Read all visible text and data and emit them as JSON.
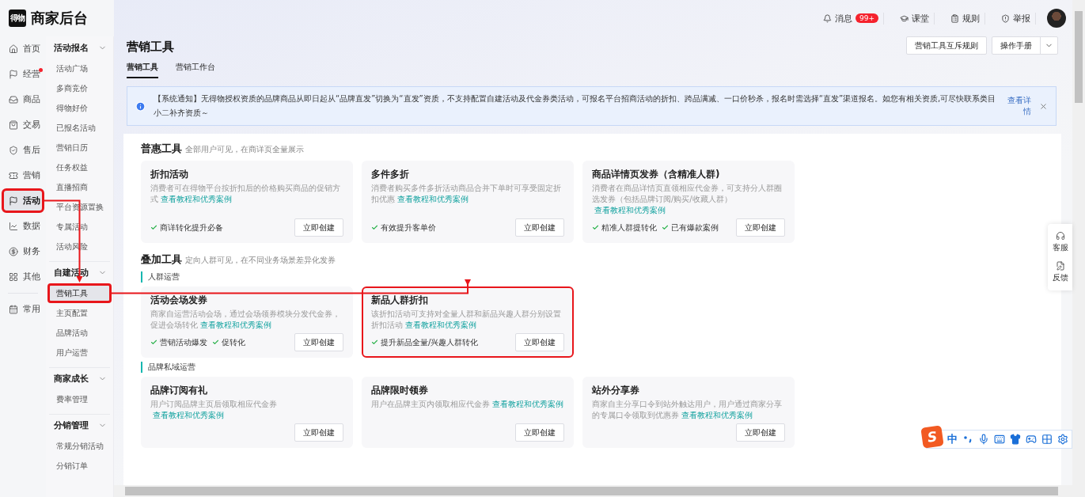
{
  "header": {
    "logo_mark": "得物",
    "title": "商家后台",
    "links": [
      {
        "kind": "messages",
        "label": "消息",
        "badge": "99+"
      },
      {
        "kind": "class",
        "label": "课堂"
      },
      {
        "kind": "rules",
        "label": "规则"
      },
      {
        "kind": "report",
        "label": "举报"
      }
    ]
  },
  "nav": [
    {
      "kind": "home",
      "label": "首页",
      "selected": false,
      "unread": false,
      "highlighted": false
    },
    {
      "kind": "flag",
      "label": "经营",
      "selected": false,
      "unread": true,
      "highlighted": false
    },
    {
      "kind": "goods",
      "label": "商品",
      "selected": false,
      "unread": false,
      "highlighted": false
    },
    {
      "kind": "trade",
      "label": "交易",
      "selected": false,
      "unread": false,
      "highlighted": false
    },
    {
      "kind": "aftersale",
      "label": "售后",
      "selected": false,
      "unread": false,
      "highlighted": false
    },
    {
      "kind": "marketing",
      "label": "营销",
      "selected": false,
      "unread": false,
      "highlighted": false
    },
    {
      "kind": "flag",
      "label": "活动",
      "selected": true,
      "unread": false,
      "highlighted": true
    },
    {
      "kind": "data",
      "label": "数据",
      "selected": false,
      "unread": false,
      "highlighted": false
    },
    {
      "kind": "finance",
      "label": "财务",
      "selected": false,
      "unread": false,
      "highlighted": false
    },
    {
      "kind": "other",
      "label": "其他",
      "selected": false,
      "unread": false,
      "highlighted": false
    },
    {
      "kind": "common",
      "label": "常用",
      "selected": false,
      "unread": false,
      "highlighted": false
    }
  ],
  "submenu": [
    {
      "title": "活动报名",
      "expanded": true,
      "items": [
        {
          "label": "活动广场",
          "selected": false,
          "highlighted": false
        },
        {
          "label": "多商竞价",
          "selected": false,
          "highlighted": false
        },
        {
          "label": "得物好价",
          "selected": false,
          "highlighted": false
        },
        {
          "label": "已报名活动",
          "selected": false,
          "highlighted": false
        },
        {
          "label": "营销日历",
          "selected": false,
          "highlighted": false
        },
        {
          "label": "任务权益",
          "selected": false,
          "highlighted": false
        },
        {
          "label": "直播招商",
          "selected": false,
          "highlighted": false
        },
        {
          "label": "平台资源置换",
          "selected": false,
          "highlighted": false
        },
        {
          "label": "专属活动",
          "selected": false,
          "highlighted": false
        },
        {
          "label": "活动风险",
          "selected": false,
          "highlighted": false
        }
      ]
    },
    {
      "title": "自建活动",
      "expanded": true,
      "items": [
        {
          "label": "营销工具",
          "selected": true,
          "highlighted": true
        },
        {
          "label": "主页配置",
          "selected": false,
          "highlighted": false
        },
        {
          "label": "品牌活动",
          "selected": false,
          "highlighted": false
        },
        {
          "label": "用户运营",
          "selected": false,
          "highlighted": false
        }
      ]
    },
    {
      "title": "商家成长",
      "expanded": true,
      "items": [
        {
          "label": "费率管理",
          "selected": false,
          "highlighted": false
        }
      ]
    },
    {
      "title": "分销管理",
      "expanded": true,
      "items": [
        {
          "label": "常规分销活动",
          "selected": false,
          "highlighted": false
        },
        {
          "label": "分销订单",
          "selected": false,
          "highlighted": false
        }
      ]
    }
  ],
  "page": {
    "title": "营销工具",
    "tabs": [
      {
        "label": "营销工具",
        "selected": true
      },
      {
        "label": "营销工作台",
        "selected": false
      }
    ],
    "rules_button": "营销工具互斥规则",
    "manual_button": "操作手册"
  },
  "notice": {
    "text": "【系统通知】无得物授权资质的品牌商品从即日起从“品牌直发”切换为“直发”资质，不支持配置自建活动及代金券类活动，可报名平台招商活动的折扣、跨品满减、一口价秒杀，报名时需选择“直发”渠道报名。如您有相关资质,可尽快联系类目小二补齐资质～",
    "link": "查看详情"
  },
  "sections": [
    {
      "title": "普惠工具",
      "subtitle": "全部用户可见，在商详页全量展示",
      "groups": [
        {
          "cards": [
            {
              "title": "折扣活动",
              "description": "消费者可在得物平台按折扣后的价格购买商品的促销方式",
              "link": "查看教程和优秀案例",
              "features": [
                "商详转化提升必备"
              ],
              "button": "立即创建",
              "highlighted": false
            },
            {
              "title": "多件多折",
              "description": "消费者购买多件多折活动商品合并下单时可享受固定折扣优惠",
              "link": "查看教程和优秀案例",
              "features": [
                "有效提升客单价"
              ],
              "button": "立即创建",
              "highlighted": false
            },
            {
              "title": "商品详情页发券（含精准人群)",
              "description": "消费者在商品详情页直领相应代金券，可支持分人群圈选发券（包括品牌订阅/购买/收藏人群）",
              "link": "查看教程和优秀案例",
              "features": [
                "精准人群提转化",
                "已有爆款案例"
              ],
              "button": "立即创建",
              "highlighted": false
            }
          ]
        }
      ]
    },
    {
      "title": "叠加工具",
      "subtitle": "定向人群可见，在不同业务场景差异化发券",
      "groups": [
        {
          "label": "人群运营",
          "cards": [
            {
              "title": "活动会场发券",
              "description": "商家自运营活动会场，通过会场领券模块分发代金券，促进会场转化",
              "link": "查看教程和优秀案例",
              "features": [
                "营销活动爆发",
                "促转化"
              ],
              "button": "立即创建",
              "highlighted": false
            },
            {
              "title": "新品人群折扣",
              "description": "该折扣活动可支持对全量人群和新品兴趣人群分别设置折扣活动",
              "link": "查看教程和优秀案例",
              "features": [
                "提升新品全量/兴趣人群转化"
              ],
              "button": "立即创建",
              "highlighted": true
            }
          ]
        },
        {
          "label": "品牌私域运营",
          "cards": [
            {
              "title": "品牌订阅有礼",
              "description": "用户订阅品牌主页后领取相应代金券",
              "link": "查看教程和优秀案例",
              "button": "立即创建",
              "highlighted": false
            },
            {
              "title": "品牌限时领券",
              "description": "用户在品牌主页内领取相应代金券",
              "link": "查看教程和优秀案例",
              "button": "立即创建",
              "highlighted": false
            },
            {
              "title": "站外分享券",
              "description": "商家自主分享口令到站外触达用户，用户通过商家分享的专属口令领取到优惠券",
              "link": "查看教程和优秀案例",
              "button": "立即创建",
              "highlighted": false
            }
          ]
        }
      ]
    }
  ],
  "side_panel": [
    {
      "kind": "service",
      "label": "客服"
    },
    {
      "kind": "feedback",
      "label": "反馈"
    }
  ],
  "ime_toolbar": {
    "logo": "S",
    "mode": "中"
  }
}
